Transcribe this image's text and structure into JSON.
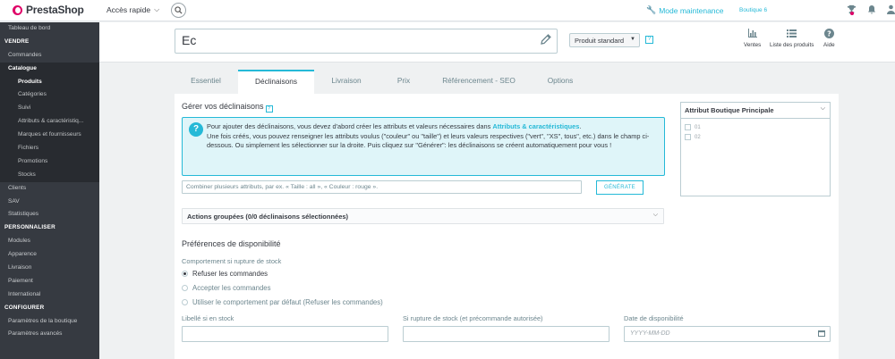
{
  "topbar": {
    "logo": "PrestaShop",
    "quick_access": "Accès rapide",
    "maintenance": "Mode maintenance",
    "shop": "Boutique 6"
  },
  "sidebar": {
    "items": [
      {
        "label": "Tableau de bord",
        "kind": "item"
      },
      {
        "label": "VENDRE",
        "kind": "section"
      },
      {
        "label": "Commandes",
        "kind": "item"
      },
      {
        "label": "Catalogue",
        "kind": "parent"
      },
      {
        "label": "Produits",
        "kind": "current"
      },
      {
        "label": "Catégories",
        "kind": "sub"
      },
      {
        "label": "Suivi",
        "kind": "sub"
      },
      {
        "label": "Attributs & caractéristiq...",
        "kind": "sub"
      },
      {
        "label": "Marques et fournisseurs",
        "kind": "sub"
      },
      {
        "label": "Fichiers",
        "kind": "sub"
      },
      {
        "label": "Promotions",
        "kind": "sub"
      },
      {
        "label": "Stocks",
        "kind": "sub"
      },
      {
        "label": "Clients",
        "kind": "item"
      },
      {
        "label": "SAV",
        "kind": "item"
      },
      {
        "label": "Statistiques",
        "kind": "item"
      },
      {
        "label": "PERSONNALISER",
        "kind": "section"
      },
      {
        "label": "Modules",
        "kind": "item"
      },
      {
        "label": "Apparence",
        "kind": "item"
      },
      {
        "label": "Livraison",
        "kind": "item"
      },
      {
        "label": "Paiement",
        "kind": "item"
      },
      {
        "label": "International",
        "kind": "item"
      },
      {
        "label": "CONFIGURER",
        "kind": "section"
      },
      {
        "label": "Paramètres de la boutique",
        "kind": "item"
      },
      {
        "label": "Paramètres avancés",
        "kind": "item"
      }
    ]
  },
  "product": {
    "name": "Ec",
    "type": "Produit standard",
    "actions": {
      "sales": "Ventes",
      "list": "Liste des produits",
      "help": "Aide"
    }
  },
  "tabs": [
    {
      "label": "Essentiel",
      "active": false
    },
    {
      "label": "Déclinaisons",
      "active": true
    },
    {
      "label": "Livraison",
      "active": false
    },
    {
      "label": "Prix",
      "active": false
    },
    {
      "label": "Référencement - SEO",
      "active": false
    },
    {
      "label": "Options",
      "active": false
    }
  ],
  "combinations": {
    "title": "Gérer vos déclinaisons",
    "info_line1_a": "Pour ajouter des déclinaisons, vous devez d'abord créer les attributs et valeurs nécessaires dans ",
    "info_link": "Attributs & caractéristiques",
    "info_line1_b": ".",
    "info_line2": "Une fois créés, vous pouvez renseigner les attributs voulus (\"couleur\" ou \"taille\") et leurs valeurs respectives (\"vert\", \"XS\", tous\", etc.) dans le champ ci-dessous. Ou simplement les sélectionner sur la droite. Puis cliquez sur \"Générer\": les déclinaisons se créent automatiquement pour vous !",
    "combo_placeholder": "Combiner plusieurs attributs, par ex. « Taille : all », « Couleur : rouge ».",
    "generate": "GÉNÉRATE",
    "bulk_actions": "Actions groupées (0/0 déclinaisons sélectionnées)"
  },
  "availability": {
    "title": "Préférences de disponibilité",
    "oos_label": "Comportement si rupture de stock",
    "options": [
      {
        "label": "Refuser les commandes",
        "checked": true
      },
      {
        "label": "Accepter les commandes",
        "checked": false
      },
      {
        "label": "Utiliser le comportement par défaut (Refuser les commandes)",
        "checked": false
      }
    ],
    "in_stock_label": "Libellé si en stock",
    "backorder_label": "Si rupture de stock (et précommande autorisée)",
    "date_label": "Date de disponibilité",
    "date_placeholder": "YYYY-MM-DD"
  },
  "attributes": {
    "title": "Attribut Boutique Principale",
    "items": [
      "01",
      "02"
    ]
  },
  "colors": {
    "accent": "#25b9d7",
    "sidebar": "#363a41",
    "brand": "#df0067"
  }
}
